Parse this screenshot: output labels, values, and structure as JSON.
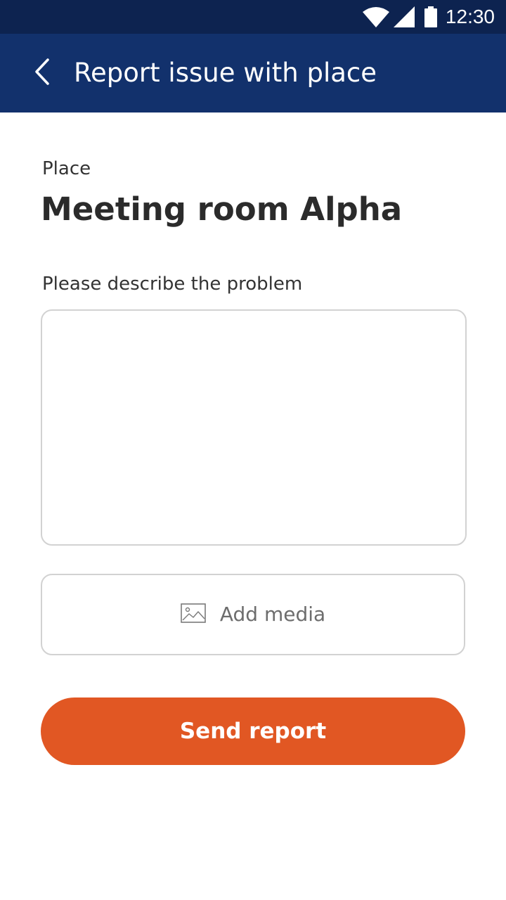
{
  "status_bar": {
    "time": "12:30",
    "icons": [
      "wifi-icon",
      "signal-icon",
      "battery-icon"
    ]
  },
  "app_bar": {
    "title": "Report issue with place",
    "back_icon": "chevron-left-icon"
  },
  "place": {
    "label": "Place",
    "name": "Meeting room Alpha"
  },
  "description": {
    "label": "Please describe the problem",
    "value": ""
  },
  "media": {
    "label": "Add media",
    "icon": "image-icon"
  },
  "send": {
    "label": "Send report"
  },
  "colors": {
    "status_bar": "#0d2350",
    "app_bar": "#12316c",
    "accent": "#e15723",
    "border": "#d2d2d2"
  }
}
